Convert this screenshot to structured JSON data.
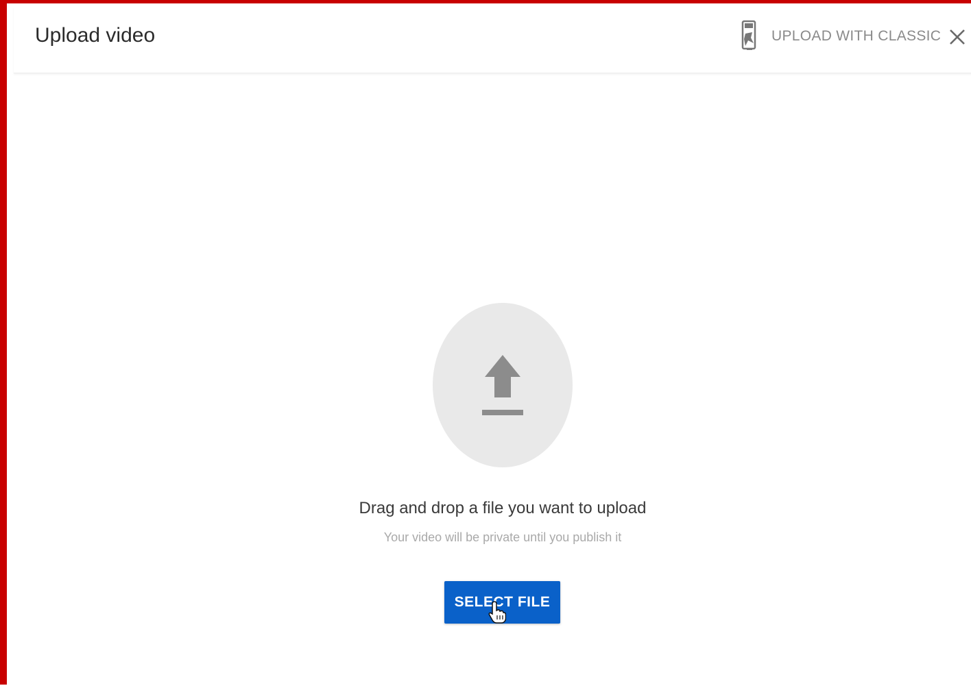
{
  "dialog": {
    "title": "Upload video",
    "classic_label": "UPLOAD WITH CLASSIC",
    "classic_icon": "classic-studio-icon",
    "close_icon": "close-icon"
  },
  "upload": {
    "icon": "upload-arrow-icon",
    "drag_text": "Drag and drop a file you want to upload",
    "private_text": "Your video will be private until you publish it",
    "select_label": "SELECT FILE"
  },
  "colors": {
    "frame_border": "#c80000",
    "button_blue": "#0a61c9",
    "circle_gray": "#e9e9e9",
    "icon_gray": "#8c8c8c"
  }
}
